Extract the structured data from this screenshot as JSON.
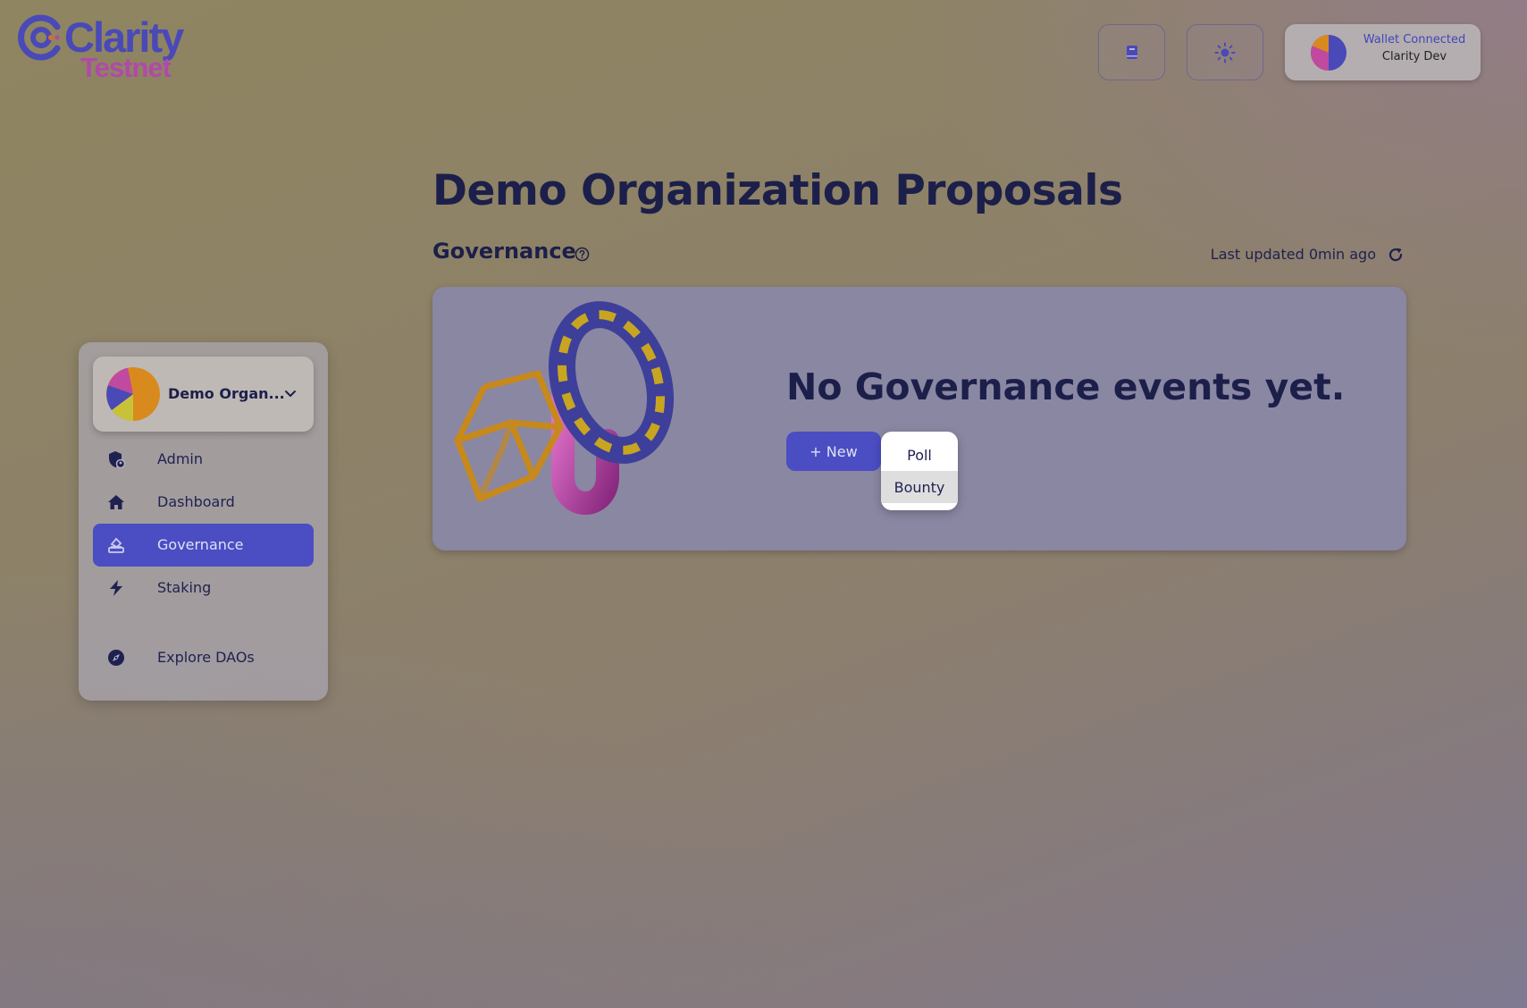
{
  "logo": {
    "name": "Clarity",
    "network": "Testnet"
  },
  "header": {
    "book_icon": "book-icon",
    "theme_icon": "sun-icon",
    "wallet": {
      "status": "Wallet Connected",
      "name": "Clarity Dev"
    }
  },
  "sidebar": {
    "org": {
      "name": "Demo Organ..."
    },
    "items": [
      {
        "label": "Admin",
        "icon": "shield-user-icon",
        "active": false
      },
      {
        "label": "Dashboard",
        "icon": "home-icon",
        "active": false
      },
      {
        "label": "Governance",
        "icon": "ballot-icon",
        "active": true
      },
      {
        "label": "Staking",
        "icon": "lightning-icon",
        "active": false
      },
      {
        "label": "Explore DAOs",
        "icon": "compass-icon",
        "active": false
      }
    ]
  },
  "main": {
    "title": "Demo Organization Proposals",
    "section": "Governance",
    "last_updated": "Last updated 0min ago",
    "empty_message": "No Governance events yet.",
    "new_button": "+ New",
    "dropdown": {
      "options": [
        "Poll",
        "Bounty"
      ],
      "highlighted": "Bounty"
    }
  },
  "colors": {
    "accent": "#4b4dc3",
    "text": "#1c1f4a",
    "logo_primary": "#4a49b8",
    "logo_secondary": "#b04aa8"
  }
}
